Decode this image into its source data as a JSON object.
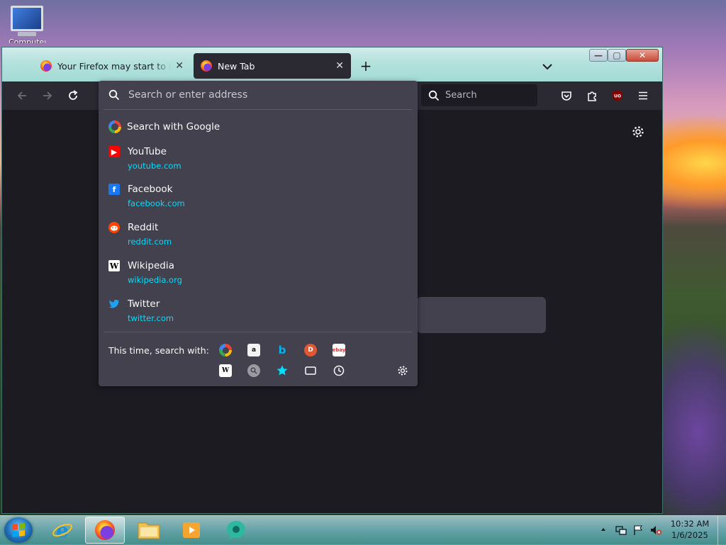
{
  "desktop": {
    "icon_label": "Computer"
  },
  "window": {
    "tabs": [
      {
        "title": "Your Firefox may start to have p",
        "close": "✕"
      },
      {
        "title": "New Tab",
        "close": "✕"
      }
    ],
    "new_tab": "+",
    "controls": {
      "minimize": "—",
      "maximize": "▢",
      "close": "✕"
    }
  },
  "toolbar": {
    "search_placeholder": "Search"
  },
  "urlbar": {
    "placeholder": "Search or enter address",
    "search_with_google": "Search with Google",
    "suggestions": [
      {
        "name": "YouTube",
        "url": "youtube.com",
        "icon": "youtube-icon",
        "color": "#ff0000"
      },
      {
        "name": "Facebook",
        "url": "facebook.com",
        "icon": "facebook-icon",
        "color": "#1877f2"
      },
      {
        "name": "Reddit",
        "url": "reddit.com",
        "icon": "reddit-icon",
        "color": "#ff4500"
      },
      {
        "name": "Wikipedia",
        "url": "wikipedia.org",
        "icon": "wikipedia-icon",
        "color": "#ffffff"
      },
      {
        "name": "Twitter",
        "url": "twitter.com",
        "icon": "twitter-icon",
        "color": "#1da1f2"
      }
    ],
    "oneoff_label": "This time, search with:",
    "engines": [
      "google-icon",
      "amazon-icon",
      "bing-icon",
      "duckduckgo-icon",
      "ebay-icon",
      "wikipedia-icon",
      "search-engine-icon",
      "bookmarks-icon",
      "tabs-icon",
      "history-icon"
    ],
    "url_color": "#00ddff"
  },
  "taskbar": {
    "time": "10:32 AM",
    "date": "1/6/2025"
  },
  "colors": {
    "toolbar_bg": "#2b2a33",
    "content_bg": "#1c1b22",
    "dropdown_bg": "#42414d"
  }
}
